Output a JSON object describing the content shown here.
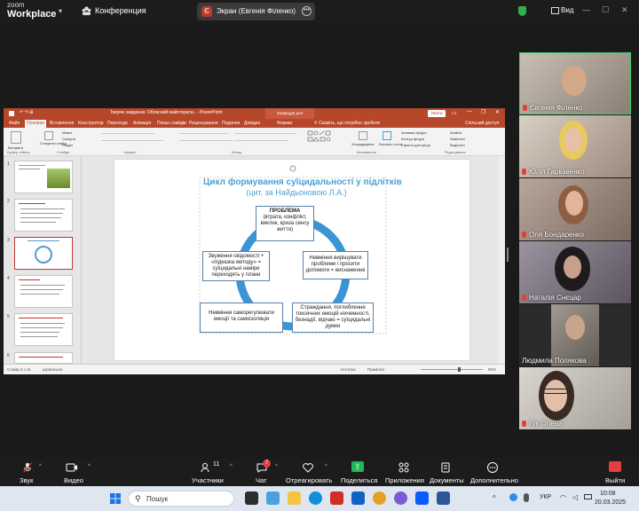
{
  "app": {
    "logo_top": "zoom",
    "logo_bottom": "Workplace",
    "conference_label": "Конференция"
  },
  "screen_share": {
    "presenter_initial": "Є",
    "label": "Экран (Евгенія Філенко)"
  },
  "view": {
    "label": "Вид"
  },
  "powerpoint": {
    "window_title": "Творче завдання. Обласний майстеркла.. - PowerPoint",
    "context_tab": "Знаряддя для зображення",
    "signin": "Увійти",
    "tabs": [
      "Файл",
      "Основне",
      "Вставлення",
      "Конструктор",
      "Переходи",
      "Анімація",
      "Показ слайдів",
      "Рецензування",
      "Подання",
      "Довідка",
      "Формат"
    ],
    "search_hint": "Скажіть, що потрібно зробити",
    "share_label": "Спільний доступ",
    "ribbon_groups": [
      "Буфер обміну",
      "Слайди",
      "Шрифт",
      "Абзац",
      "Малювання",
      "Редагування"
    ],
    "ribbon_items": {
      "layout": "Макет",
      "reset": "Скинути",
      "section": "Розділ",
      "new_slide": "Створити слайд",
      "paste": "Вставити",
      "arrange": "Упорядкувати",
      "express_styles": "Експрес-стилі",
      "fill": "Заливка фігури",
      "outline": "Контур фігури",
      "effects": "Ефекти для фігур",
      "find": "Знайти",
      "replace": "Замінити",
      "select": "Виділити"
    },
    "slide": {
      "title": "Цикл формування суїцидальності у підлітків",
      "subtitle": "(цит. за Найдьоновою Л.А.)",
      "box_problem_title": "ПРОБЛЕМА",
      "box_problem_body": "(втрата, конфлікт, виклик, криза сенсу життя)",
      "box_right": "Невміння вирішувати проблеми і просити допомоги = виснаження",
      "box_bottom_right": "Страждання, поглиблення токсичних емоцій ніхчемності, безнадії, відчаю = суїцидальні думки",
      "box_bottom_left": "Невміння саморегулювати емоції та самоізоляція",
      "box_left": "Звуження свідомості + «підказка методу» = суїцидальні наміри переходять у плани"
    },
    "thumbs": [
      {
        "num": "1"
      },
      {
        "num": "2"
      },
      {
        "num": "3"
      },
      {
        "num": "4"
      },
      {
        "num": "5"
      },
      {
        "num": "6"
      }
    ],
    "status": {
      "slide": "Слайд 3 з 11",
      "lang": "українська",
      "notes": "Нотатки",
      "comments": "Примітки",
      "zoom": "85%"
    }
  },
  "participants_gallery": [
    {
      "name": "Євгенія Філенко",
      "bg": "#8a7f74"
    },
    {
      "name": "Юлія Гаркавенко",
      "bg": "#9c8a7e"
    },
    {
      "name": "Оля Бондаренко",
      "bg": "#7b6a60"
    },
    {
      "name": "Наталія Снєцар",
      "bg": "#5c5560"
    },
    {
      "name": "Людмила Полякова",
      "bg": "#6e6a66"
    },
    {
      "name": "Гук Олена",
      "bg": "#a5a099"
    }
  ],
  "toolbar": {
    "audio": "Звук",
    "video": "Видео",
    "participants": "Участники",
    "participants_count": "11",
    "chat": "Чат",
    "chat_badge": "7",
    "react": "Отреагировать",
    "share": "Поделиться",
    "apps": "Приложения",
    "docs": "Документы",
    "more": "Дополнительно",
    "leave": "Выйти"
  },
  "taskbar": {
    "search": "Пошук",
    "lang": "УКР",
    "time": "10:08",
    "date": "20.03.2025"
  },
  "colors": {
    "accent": "#b7472a",
    "zoom_share": "#1db954",
    "slide_blue": "#4e9ed1"
  }
}
